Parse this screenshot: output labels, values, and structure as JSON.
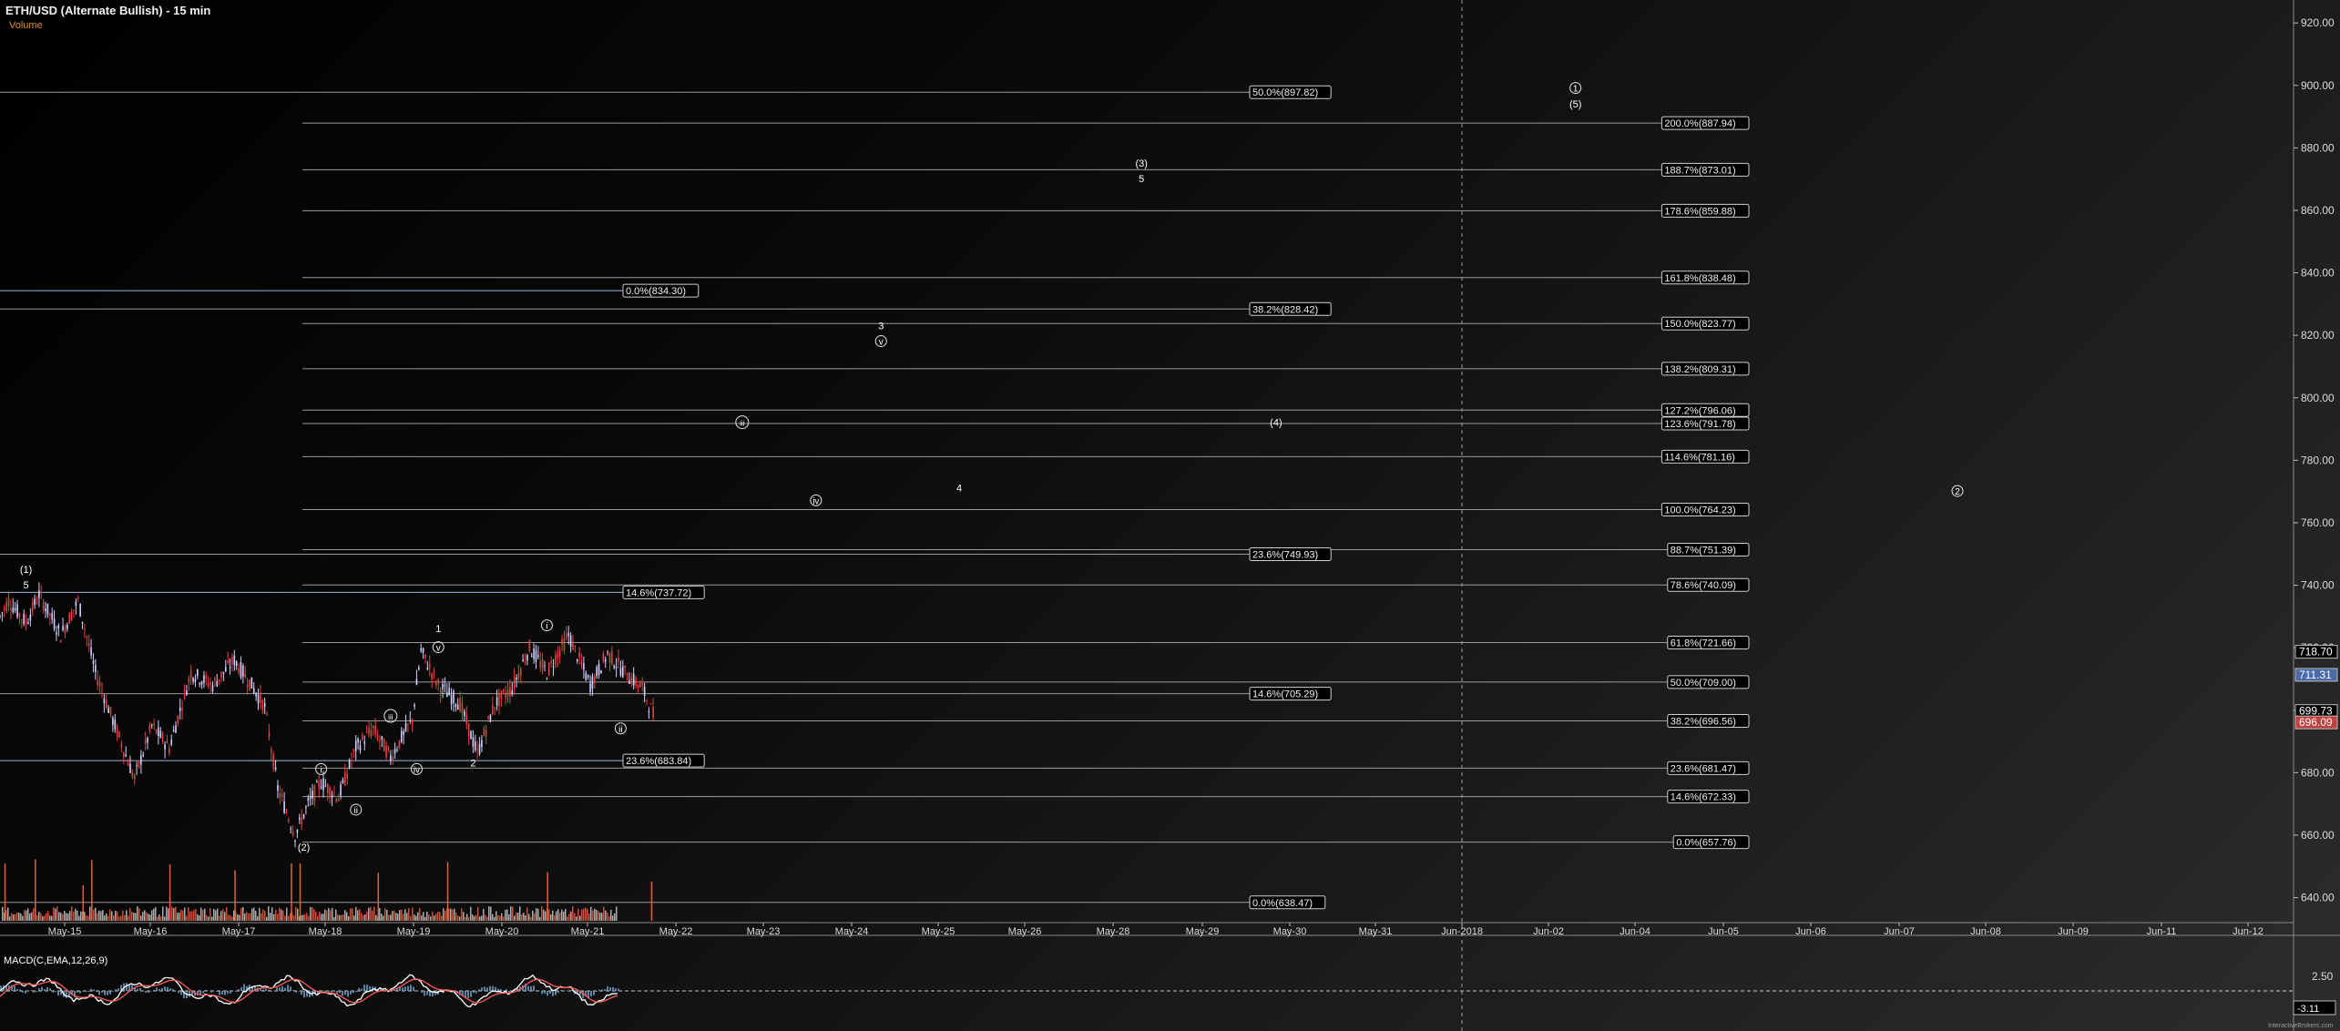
{
  "header": {
    "title": "ETH/USD (Alternate Bullish) - 15 min",
    "volume_label": "Volume"
  },
  "macd": {
    "label": "MACD(C,EMA,12,26,9)",
    "tick_value": "2.50",
    "last_value": "-3.11"
  },
  "watermark": "InteractiveBrokers.com",
  "colors": {
    "background_dark": "#000000",
    "up_candle": "#d0d0ff",
    "down_candle": "#e04040",
    "fib_line": "#9a9a9a",
    "retrace_line": "#a0b4e0",
    "volume": "#e06040",
    "macd_line": "#ffffff",
    "signal_line": "#ff5a5a",
    "histogram": "#6fa0c8",
    "price_tag_up": "#4a6aa8",
    "price_tag_down": "#c04040"
  },
  "chart_data": {
    "type": "candlestick",
    "title": "ETH/USD (Alternate Bullish) - 15 min",
    "ylim": [
      632,
      925
    ],
    "y_ticks": [
      640,
      660,
      680,
      700,
      720,
      740,
      760,
      780,
      800,
      820,
      840,
      860,
      880,
      900,
      920
    ],
    "y_tick_labels": [
      "640.00",
      "660.00",
      "680.00",
      "700.00",
      "720.00",
      "740.00",
      "760.00",
      "780.00",
      "800.00",
      "820.00",
      "840.00",
      "860.00",
      "880.00",
      "900.00",
      "920.00"
    ],
    "x_labels": [
      "May-15",
      "May-16",
      "May-17",
      "May-18",
      "May-19",
      "May-20",
      "May-21",
      "May-22",
      "May-23",
      "May-24",
      "May-25",
      "May-26",
      "May-28",
      "May-29",
      "May-30",
      "May-31",
      "Jun-2018",
      "Jun-02",
      "Jun-04",
      "Jun-05",
      "Jun-06",
      "Jun-07",
      "Jun-08",
      "Jun-09",
      "Jun-11",
      "Jun-12"
    ],
    "price_path": [
      [
        0,
        730
      ],
      [
        0.1,
        735
      ],
      [
        0.3,
        728
      ],
      [
        0.45,
        737
      ],
      [
        0.7,
        724
      ],
      [
        0.9,
        735
      ],
      [
        1.1,
        712
      ],
      [
        1.35,
        693
      ],
      [
        1.55,
        678
      ],
      [
        1.75,
        695
      ],
      [
        1.95,
        688
      ],
      [
        2.2,
        712
      ],
      [
        2.45,
        708
      ],
      [
        2.7,
        716
      ],
      [
        2.9,
        708
      ],
      [
        3.05,
        701
      ],
      [
        3.2,
        675
      ],
      [
        3.4,
        660
      ],
      [
        3.55,
        670
      ],
      [
        3.7,
        677
      ],
      [
        3.9,
        672
      ],
      [
        4.1,
        688
      ],
      [
        4.3,
        694
      ],
      [
        4.5,
        685
      ],
      [
        4.75,
        697
      ],
      [
        4.85,
        719
      ],
      [
        5.05,
        708
      ],
      [
        5.3,
        702
      ],
      [
        5.5,
        686
      ],
      [
        5.7,
        702
      ],
      [
        5.9,
        707
      ],
      [
        6.1,
        720
      ],
      [
        6.3,
        712
      ],
      [
        6.55,
        724
      ],
      [
        6.8,
        708
      ],
      [
        7.0,
        718
      ],
      [
        7.2,
        712
      ],
      [
        7.4,
        707
      ],
      [
        7.55,
        697
      ]
    ],
    "volume_spikes": [
      0.05,
      0.4,
      0.95,
      1.05,
      1.95,
      2.7,
      3.35,
      3.45,
      4.35,
      5.15,
      6.3,
      7.5
    ],
    "last_price": 696.09,
    "price_tags": [
      {
        "value": 718.7,
        "label": "718.70",
        "kind": "plain"
      },
      {
        "value": 711.31,
        "label": "711.31",
        "kind": "up"
      },
      {
        "value": 699.73,
        "label": "699.73",
        "kind": "plain"
      },
      {
        "value": 696.09,
        "label": "696.09",
        "kind": "down"
      }
    ],
    "fib_right": [
      {
        "value": 887.94,
        "label": "200.0%(887.94)"
      },
      {
        "value": 873.01,
        "label": "188.7%(873.01)"
      },
      {
        "value": 859.88,
        "label": "178.6%(859.88)"
      },
      {
        "value": 838.48,
        "label": "161.8%(838.48)"
      },
      {
        "value": 823.77,
        "label": "150.0%(823.77)"
      },
      {
        "value": 809.31,
        "label": "138.2%(809.31)"
      },
      {
        "value": 796.06,
        "label": "127.2%(796.06)"
      },
      {
        "value": 791.78,
        "label": "123.6%(791.78)"
      },
      {
        "value": 781.16,
        "label": "114.6%(781.16)"
      },
      {
        "value": 764.23,
        "label": "100.0%(764.23)"
      },
      {
        "value": 751.39,
        "label": "88.7%(751.39)"
      },
      {
        "value": 740.09,
        "label": "78.6%(740.09)"
      },
      {
        "value": 721.66,
        "label": "61.8%(721.66)"
      },
      {
        "value": 709.0,
        "label": "50.0%(709.00)"
      },
      {
        "value": 696.56,
        "label": "38.2%(696.56)"
      },
      {
        "value": 681.47,
        "label": "23.6%(681.47)"
      },
      {
        "value": 672.33,
        "label": "14.6%(672.33)"
      },
      {
        "value": 657.76,
        "label": "0.0%(657.76)"
      }
    ],
    "fib_mid": [
      {
        "value": 897.82,
        "label": "50.0%(897.82)"
      },
      {
        "value": 828.42,
        "label": "38.2%(828.42)"
      },
      {
        "value": 749.93,
        "label": "23.6%(749.93)"
      },
      {
        "value": 705.29,
        "label": "14.6%(705.29)"
      },
      {
        "value": 638.47,
        "label": "0.0%(638.47)"
      }
    ],
    "fib_left": [
      {
        "value": 834.3,
        "label": "0.0%(834.30)"
      },
      {
        "value": 737.72,
        "label": "14.6%(737.72)"
      },
      {
        "value": 683.84,
        "label": "23.6%(683.84)"
      }
    ],
    "wave_labels": [
      {
        "t": 0.3,
        "v": 744,
        "text": "(1)"
      },
      {
        "t": 0.3,
        "v": 739,
        "text": "5"
      },
      {
        "t": 3.5,
        "v": 655,
        "text": "(2)"
      },
      {
        "t": 5.05,
        "v": 725,
        "text": "1"
      },
      {
        "t": 5.05,
        "v": 719,
        "text": "v",
        "circled": true
      },
      {
        "t": 5.45,
        "v": 682,
        "text": "2"
      },
      {
        "t": 3.7,
        "v": 680,
        "text": "i",
        "circled": true
      },
      {
        "t": 4.1,
        "v": 667,
        "text": "ii",
        "circled": true
      },
      {
        "t": 4.5,
        "v": 697,
        "text": "iii",
        "circled": true
      },
      {
        "t": 4.8,
        "v": 680,
        "text": "iv",
        "circled": true
      },
      {
        "t": 6.3,
        "v": 726,
        "text": "i",
        "circled": true
      },
      {
        "t": 7.15,
        "v": 693,
        "text": "ii",
        "circled": true
      },
      {
        "t": 8.55,
        "v": 791,
        "text": "iii",
        "circled": true
      },
      {
        "t": 9.4,
        "v": 766,
        "text": "iv",
        "circled": true
      },
      {
        "t": 10.15,
        "v": 822,
        "text": "3"
      },
      {
        "t": 10.15,
        "v": 817,
        "text": "v",
        "circled": true
      },
      {
        "t": 11.05,
        "v": 770,
        "text": "4"
      },
      {
        "t": 13.15,
        "v": 874,
        "text": "(3)"
      },
      {
        "t": 13.15,
        "v": 869,
        "text": "5"
      },
      {
        "t": 14.7,
        "v": 791,
        "text": "(4)"
      },
      {
        "t": 18.15,
        "v": 898,
        "text": "1",
        "circled": true
      },
      {
        "t": 18.15,
        "v": 893,
        "text": "(5)"
      },
      {
        "t": 22.55,
        "v": 769,
        "text": "2",
        "circled": true
      }
    ]
  }
}
